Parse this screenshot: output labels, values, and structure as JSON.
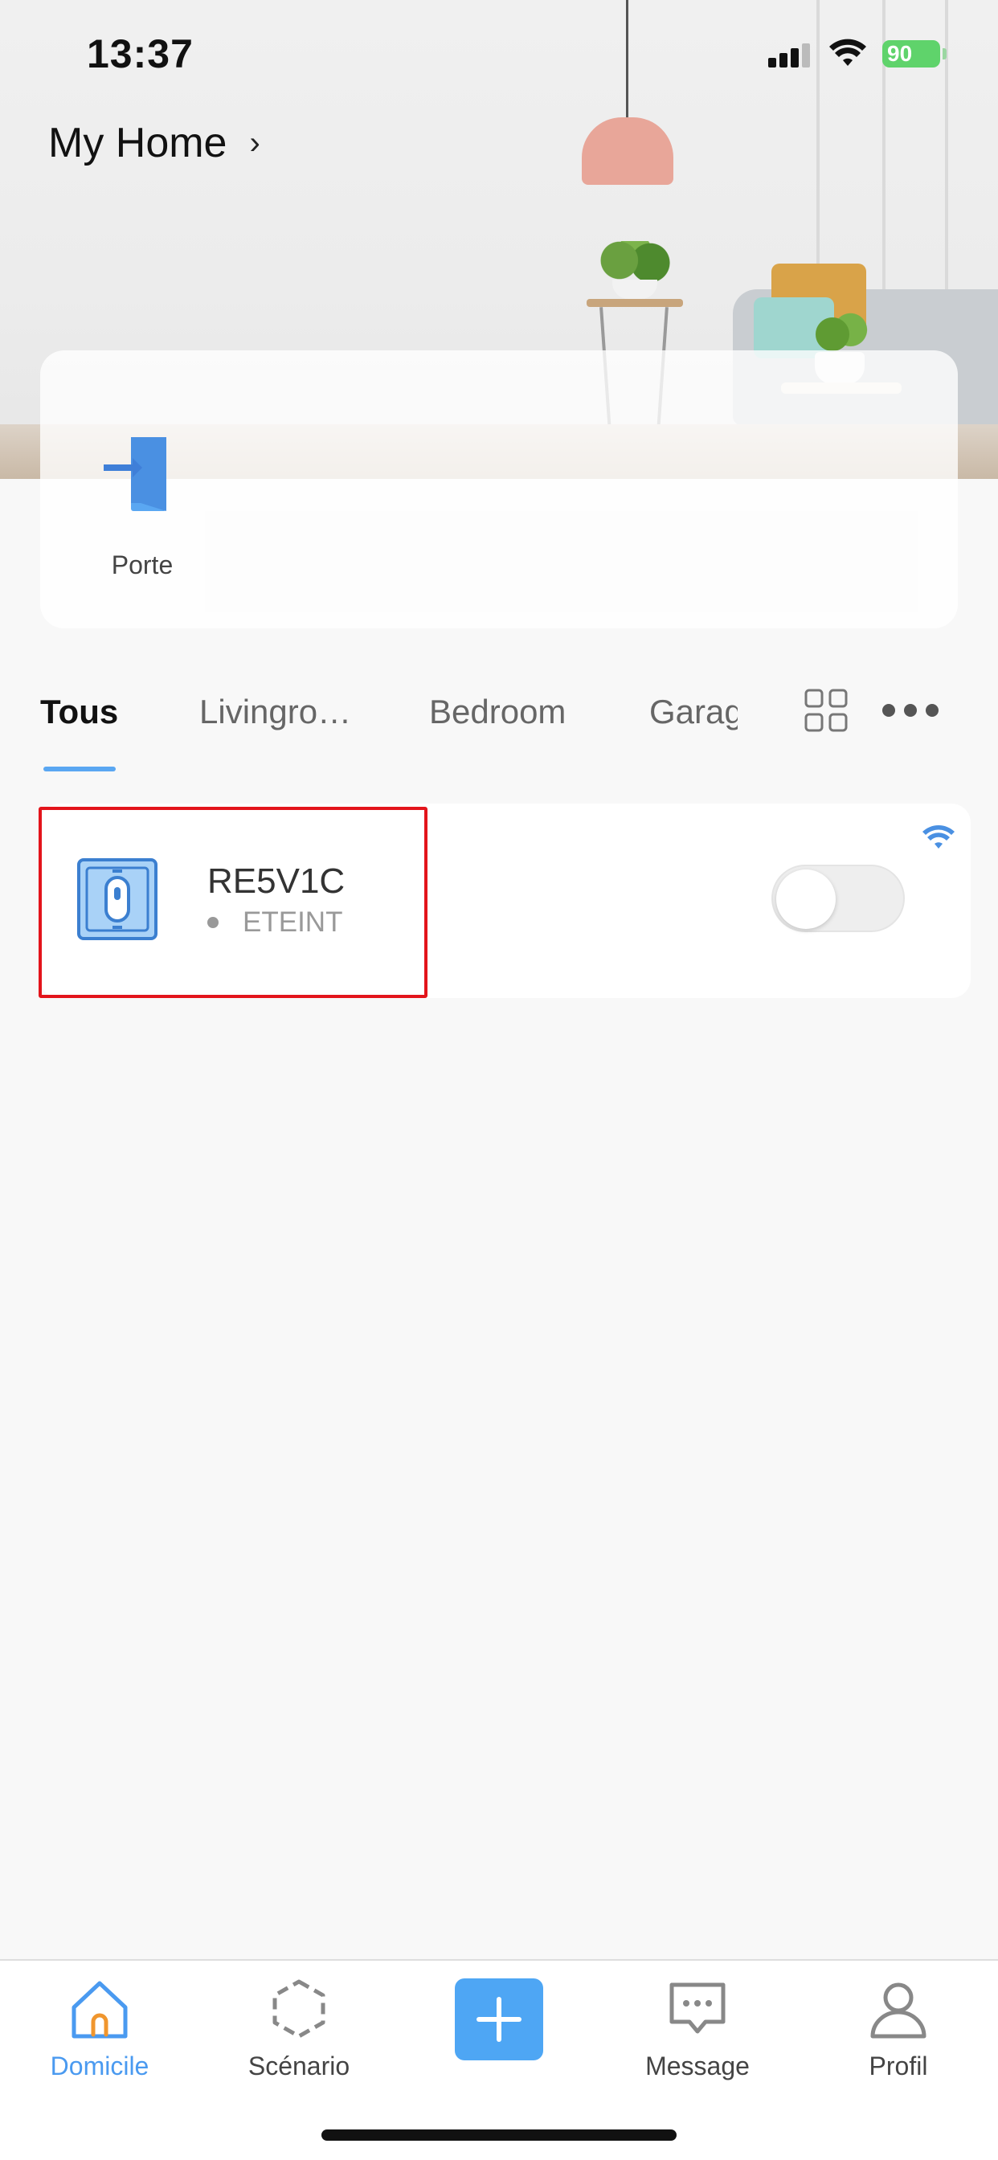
{
  "status_bar": {
    "time": "13:37",
    "battery": "90"
  },
  "home": {
    "title": "My Home",
    "chevron": "›"
  },
  "scenes": [
    {
      "label": "Porte",
      "icon": "door-enter-icon"
    }
  ],
  "tabs": [
    {
      "label": "Tous",
      "active": true
    },
    {
      "label": "Livingro…",
      "active": false
    },
    {
      "label": "Bedroom",
      "active": false
    },
    {
      "label": "Garag",
      "active": false
    }
  ],
  "device": {
    "name": "RE5V1C",
    "status": "ETEINT",
    "icon": "wall-switch-icon",
    "power_on": false
  },
  "bottom_nav": [
    {
      "label": "Domicile",
      "icon": "home-icon",
      "active": true
    },
    {
      "label": "Scénario",
      "icon": "scenario-hexagon-icon",
      "active": false
    },
    {
      "label": "",
      "icon": "plus-icon",
      "active": false
    },
    {
      "label": "Message",
      "icon": "message-icon",
      "active": false
    },
    {
      "label": "Profil",
      "icon": "profile-icon",
      "active": false
    }
  ],
  "colors": {
    "accent": "#4ea6f4",
    "highlight": "#e3141b",
    "battery": "#5fd36b"
  }
}
